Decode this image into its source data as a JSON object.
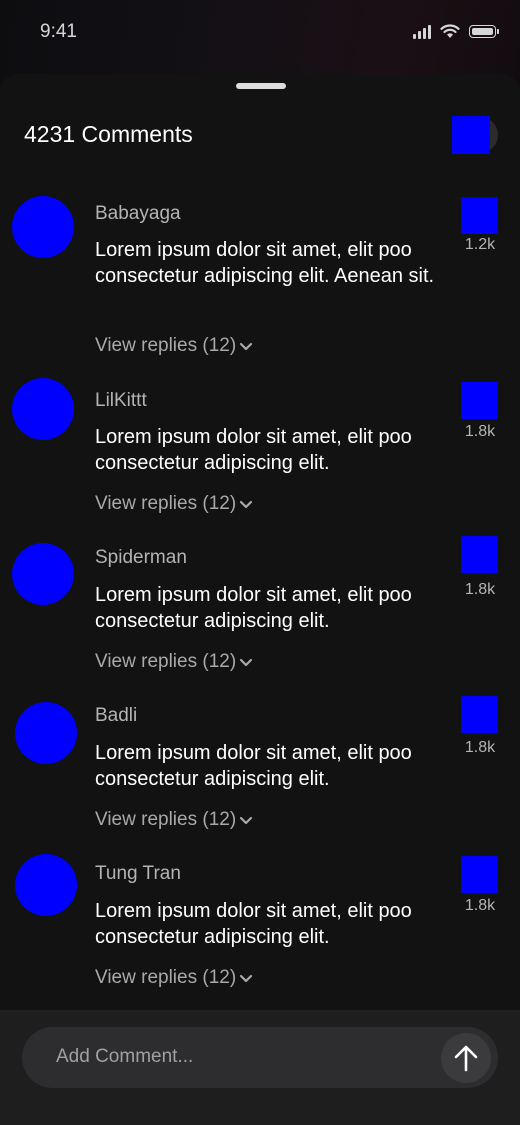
{
  "status_bar": {
    "time": "9:41",
    "icons": [
      "signal-icon",
      "wifi-icon",
      "battery-icon"
    ]
  },
  "sheet": {
    "title": "4231 Comments",
    "close_icon": "close-icon"
  },
  "comments": [
    {
      "user": "Babayaga",
      "text": "Lorem ipsum dolor sit amet, elit poo consectetur adipiscing elit. Aenean sit.",
      "replies": "View replies (12)",
      "likes": "1.2k"
    },
    {
      "user": "LilKittt",
      "text": "Lorem ipsum dolor sit amet, elit poo consectetur adipiscing elit.",
      "replies": "View replies (12)",
      "likes": "1.8k"
    },
    {
      "user": "Spiderman",
      "text": "Lorem ipsum dolor sit amet, elit poo consectetur adipiscing elit.",
      "replies": "View replies (12)",
      "likes": "1.8k"
    },
    {
      "user": "Badli",
      "text": "Lorem ipsum dolor sit amet, elit poo consectetur adipiscing elit.",
      "replies": "View replies (12)",
      "likes": "1.8k"
    },
    {
      "user": "Tung Tran",
      "text": "Lorem ipsum dolor sit amet, elit poo consectetur adipiscing elit.",
      "replies": "View replies (12)",
      "likes": "1.8k"
    }
  ],
  "composer": {
    "placeholder": "Add Comment...",
    "send_icon": "arrow-up-icon"
  },
  "colors": {
    "background": "#121212",
    "placeholder_blue": "#0000ff",
    "text": "#ffffff",
    "muted": "#b4b4b4"
  }
}
